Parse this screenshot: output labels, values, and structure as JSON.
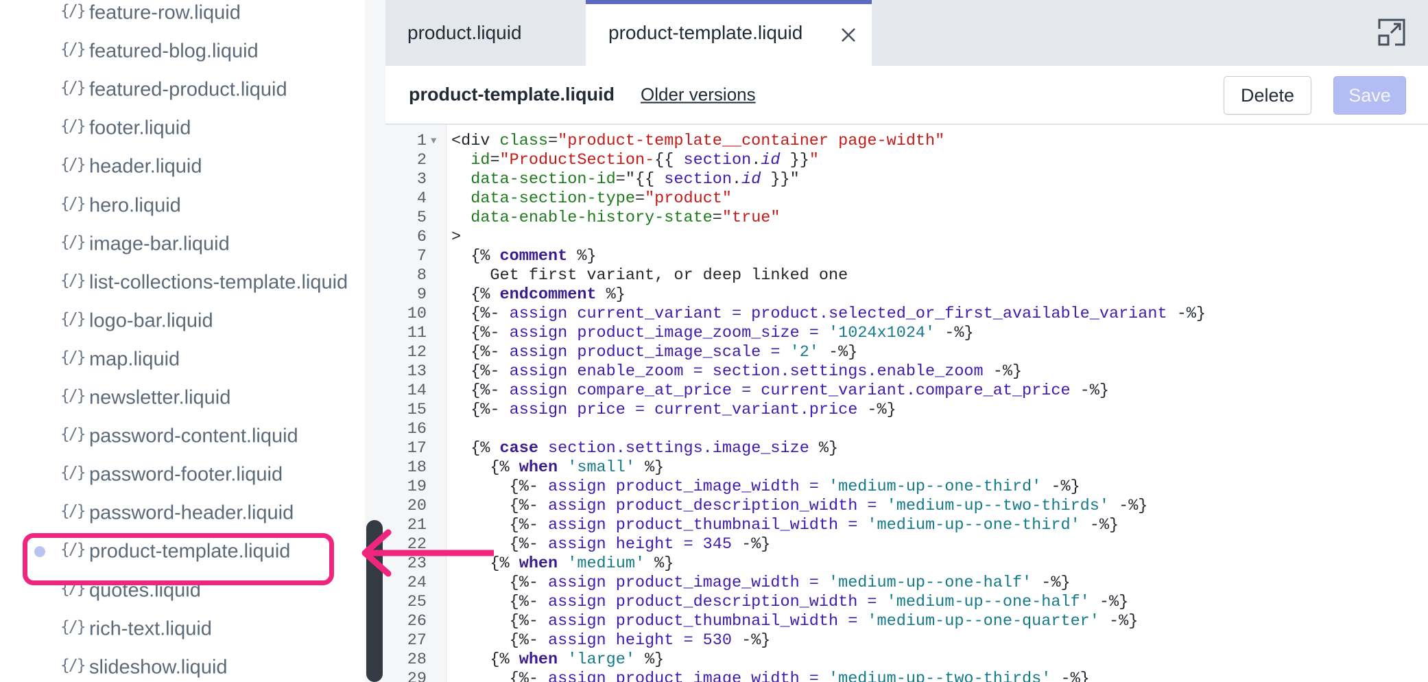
{
  "sidebar": {
    "files": [
      {
        "icon": "{/}",
        "name": "feature-row.liquid",
        "active": false
      },
      {
        "icon": "{/}",
        "name": "featured-blog.liquid",
        "active": false
      },
      {
        "icon": "{/}",
        "name": "featured-product.liquid",
        "active": false
      },
      {
        "icon": "{/}",
        "name": "footer.liquid",
        "active": false
      },
      {
        "icon": "{/}",
        "name": "header.liquid",
        "active": false
      },
      {
        "icon": "{/}",
        "name": "hero.liquid",
        "active": false
      },
      {
        "icon": "{/}",
        "name": "image-bar.liquid",
        "active": false
      },
      {
        "icon": "{/}",
        "name": "list-collections-template.liquid",
        "active": false
      },
      {
        "icon": "{/}",
        "name": "logo-bar.liquid",
        "active": false
      },
      {
        "icon": "{/}",
        "name": "map.liquid",
        "active": false
      },
      {
        "icon": "{/}",
        "name": "newsletter.liquid",
        "active": false
      },
      {
        "icon": "{/}",
        "name": "password-content.liquid",
        "active": false
      },
      {
        "icon": "{/}",
        "name": "password-footer.liquid",
        "active": false
      },
      {
        "icon": "{/}",
        "name": "password-header.liquid",
        "active": false
      },
      {
        "icon": "{/}",
        "name": "product-template.liquid",
        "active": true
      },
      {
        "icon": "{/}",
        "name": "quotes.liquid",
        "active": false
      },
      {
        "icon": "{/}",
        "name": "rich-text.liquid",
        "active": false
      },
      {
        "icon": "{/}",
        "name": "slideshow.liquid",
        "active": false
      }
    ]
  },
  "tabs": [
    {
      "label": "product.liquid",
      "active": false
    },
    {
      "label": "product-template.liquid",
      "active": true,
      "close_icon": "close-icon"
    }
  ],
  "toolbar": {
    "file_title": "product-template.liquid",
    "older_versions": "Older versions",
    "delete_label": "Delete",
    "save_label": "Save"
  },
  "editor": {
    "lines": [
      {
        "n": "1",
        "tokens": [
          [
            "",
            "<div "
          ],
          [
            "attr",
            "class"
          ],
          [
            "",
            "="
          ],
          [
            "str",
            "\"product-template__container page-width\""
          ]
        ]
      },
      {
        "n": "2",
        "tokens": [
          [
            "",
            "  "
          ],
          [
            "attr",
            "id"
          ],
          [
            "",
            "="
          ],
          [
            "str",
            "\"ProductSection-"
          ],
          [
            "",
            "{{ "
          ],
          [
            "obj",
            "section"
          ],
          [
            "",
            "."
          ],
          [
            "prop",
            "id"
          ],
          [
            "",
            " }}"
          ],
          [
            "str",
            "\""
          ]
        ]
      },
      {
        "n": "3",
        "tokens": [
          [
            "",
            "  "
          ],
          [
            "attr",
            "data-section-id"
          ],
          [
            "",
            "=\"{{ "
          ],
          [
            "obj",
            "section"
          ],
          [
            "",
            "."
          ],
          [
            "prop",
            "id"
          ],
          [
            "",
            " }}\""
          ]
        ]
      },
      {
        "n": "4",
        "tokens": [
          [
            "",
            "  "
          ],
          [
            "attr",
            "data-section-type"
          ],
          [
            "",
            "="
          ],
          [
            "str",
            "\"product\""
          ]
        ]
      },
      {
        "n": "5",
        "tokens": [
          [
            "",
            "  "
          ],
          [
            "attr",
            "data-enable-history-state"
          ],
          [
            "",
            "="
          ],
          [
            "str",
            "\"true\""
          ]
        ]
      },
      {
        "n": "6",
        "tokens": [
          [
            "",
            ">"
          ]
        ]
      },
      {
        "n": "7",
        "tokens": [
          [
            "",
            "  {% "
          ],
          [
            "kw",
            "comment"
          ],
          [
            "",
            " %}"
          ]
        ]
      },
      {
        "n": "8",
        "tokens": [
          [
            "",
            "    Get first variant, or deep linked one"
          ]
        ]
      },
      {
        "n": "9",
        "tokens": [
          [
            "",
            "  {% "
          ],
          [
            "kw",
            "endcomment"
          ],
          [
            "",
            " %}"
          ]
        ]
      },
      {
        "n": "10",
        "tokens": [
          [
            "",
            "  {%- "
          ],
          [
            "var",
            "assign current_variant = product.selected_or_first_available_variant"
          ],
          [
            "",
            " -%}"
          ]
        ]
      },
      {
        "n": "11",
        "tokens": [
          [
            "",
            "  {%- "
          ],
          [
            "var",
            "assign product_image_zoom_size = "
          ],
          [
            "sstr",
            "'1024x1024'"
          ],
          [
            "",
            " -%}"
          ]
        ]
      },
      {
        "n": "12",
        "tokens": [
          [
            "",
            "  {%- "
          ],
          [
            "var",
            "assign product_image_scale = "
          ],
          [
            "sstr",
            "'2'"
          ],
          [
            "",
            " -%}"
          ]
        ]
      },
      {
        "n": "13",
        "tokens": [
          [
            "",
            "  {%- "
          ],
          [
            "var",
            "assign enable_zoom = section.settings.enable_zoom"
          ],
          [
            "",
            " -%}"
          ]
        ]
      },
      {
        "n": "14",
        "tokens": [
          [
            "",
            "  {%- "
          ],
          [
            "var",
            "assign compare_at_price = current_variant.compare_at_price"
          ],
          [
            "",
            " -%}"
          ]
        ]
      },
      {
        "n": "15",
        "tokens": [
          [
            "",
            "  {%- "
          ],
          [
            "var",
            "assign price = current_variant.price"
          ],
          [
            "",
            " -%}"
          ]
        ]
      },
      {
        "n": "16",
        "tokens": [
          [
            "",
            ""
          ]
        ]
      },
      {
        "n": "17",
        "tokens": [
          [
            "",
            "  {% "
          ],
          [
            "kw",
            "case"
          ],
          [
            "",
            " "
          ],
          [
            "var",
            "section.settings.image_size"
          ],
          [
            "",
            " %}"
          ]
        ]
      },
      {
        "n": "18",
        "tokens": [
          [
            "",
            "    {% "
          ],
          [
            "kw",
            "when"
          ],
          [
            "",
            " "
          ],
          [
            "sstr",
            "'small'"
          ],
          [
            "",
            " %}"
          ]
        ]
      },
      {
        "n": "19",
        "tokens": [
          [
            "",
            "      {%- "
          ],
          [
            "var",
            "assign product_image_width = "
          ],
          [
            "sstr",
            "'medium-up--one-third'"
          ],
          [
            "",
            " -%}"
          ]
        ]
      },
      {
        "n": "20",
        "tokens": [
          [
            "",
            "      {%- "
          ],
          [
            "var",
            "assign product_description_width = "
          ],
          [
            "sstr",
            "'medium-up--two-thirds'"
          ],
          [
            "",
            " -%}"
          ]
        ]
      },
      {
        "n": "21",
        "tokens": [
          [
            "",
            "      {%- "
          ],
          [
            "var",
            "assign product_thumbnail_width = "
          ],
          [
            "sstr",
            "'medium-up--one-third'"
          ],
          [
            "",
            " -%}"
          ]
        ]
      },
      {
        "n": "22",
        "tokens": [
          [
            "",
            "      {%- "
          ],
          [
            "var",
            "assign height = 345"
          ],
          [
            "",
            " -%}"
          ]
        ]
      },
      {
        "n": "23",
        "tokens": [
          [
            "",
            "    {% "
          ],
          [
            "kw",
            "when"
          ],
          [
            "",
            " "
          ],
          [
            "sstr",
            "'medium'"
          ],
          [
            "",
            " %}"
          ]
        ]
      },
      {
        "n": "24",
        "tokens": [
          [
            "",
            "      {%- "
          ],
          [
            "var",
            "assign product_image_width = "
          ],
          [
            "sstr",
            "'medium-up--one-half'"
          ],
          [
            "",
            " -%}"
          ]
        ]
      },
      {
        "n": "25",
        "tokens": [
          [
            "",
            "      {%- "
          ],
          [
            "var",
            "assign product_description_width = "
          ],
          [
            "sstr",
            "'medium-up--one-half'"
          ],
          [
            "",
            " -%}"
          ]
        ]
      },
      {
        "n": "26",
        "tokens": [
          [
            "",
            "      {%- "
          ],
          [
            "var",
            "assign product_thumbnail_width = "
          ],
          [
            "sstr",
            "'medium-up--one-quarter'"
          ],
          [
            "",
            " -%}"
          ]
        ]
      },
      {
        "n": "27",
        "tokens": [
          [
            "",
            "      {%- "
          ],
          [
            "var",
            "assign height = 530"
          ],
          [
            "",
            " -%}"
          ]
        ]
      },
      {
        "n": "28",
        "tokens": [
          [
            "",
            "    {% "
          ],
          [
            "kw",
            "when"
          ],
          [
            "",
            " "
          ],
          [
            "sstr",
            "'large'"
          ],
          [
            "",
            " %}"
          ]
        ]
      },
      {
        "n": "29",
        "tokens": [
          [
            "",
            "      {%- "
          ],
          [
            "var",
            "assign product_image_width = "
          ],
          [
            "sstr",
            "'medium-up--two-thirds'"
          ],
          [
            "",
            " -%}"
          ]
        ]
      }
    ]
  },
  "annotation": {
    "highlight_color": "#f0267e",
    "arrow_color": "#f0267e"
  }
}
